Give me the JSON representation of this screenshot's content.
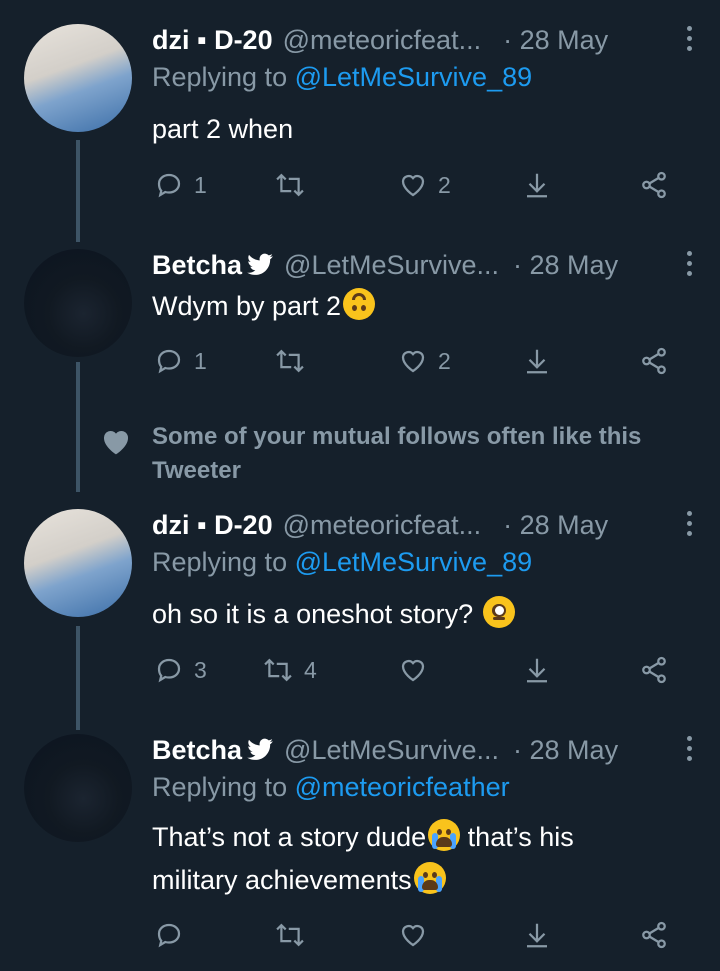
{
  "tweets": [
    {
      "name": "dzi ▪ D-20",
      "verified": false,
      "handle": "@meteoricfeat...",
      "date": "· 28 May",
      "reply_prefix": "Replying to ",
      "reply_to": "@LetMeSurvive_89",
      "text": "part 2 when",
      "replies": "1",
      "retweets": "",
      "likes": "2"
    },
    {
      "name": "Betcha",
      "verified": true,
      "handle": "@LetMeSurvive...",
      "date": "· 28 May",
      "text": "Wdym by part 2",
      "text_emoji": "upside-down-face",
      "replies": "1",
      "retweets": "",
      "likes": "2"
    },
    {
      "name": "dzi ▪ D-20",
      "verified": false,
      "handle": "@meteoricfeat...",
      "date": "· 28 May",
      "reply_prefix": "Replying to ",
      "reply_to": "@LetMeSurvive_89",
      "text": "oh so it is a oneshot story?",
      "text_emoji": "eye-roll-face",
      "replies": "3",
      "retweets": "4",
      "likes": ""
    },
    {
      "name": "Betcha",
      "verified": true,
      "handle": "@LetMeSurvive...",
      "date": "· 28 May",
      "reply_prefix": "Replying to ",
      "reply_to": "@meteoricfeather",
      "text_part1": "That’s not a story dude",
      "text_part2": " that’s his",
      "text_part3": "military achievements",
      "text_emoji": "loudly-crying-face",
      "replies": "",
      "retweets": "",
      "likes": ""
    }
  ],
  "hint": {
    "icon": "heart-icon",
    "text": "Some of your mutual follows often like this Tweeter"
  },
  "colors": {
    "background": "#15202b",
    "secondary_text": "#8899a6",
    "mention": "#1d9bf0",
    "thread_line": "#3d5466"
  }
}
